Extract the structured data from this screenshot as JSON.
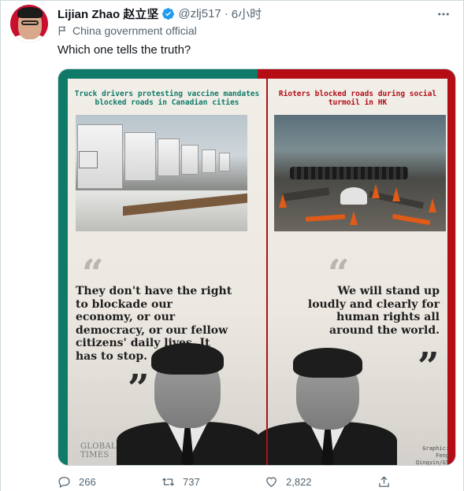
{
  "tweet": {
    "display_name": "Lijian Zhao 赵立坚",
    "handle": "@zlj517",
    "separator": "·",
    "time": "6小时",
    "affiliation": "China government official",
    "text": "Which one tells the truth?",
    "more_icon": "more-horizontal-icon",
    "verified_icon": "verified-badge-icon",
    "accent": "#1d9bf0"
  },
  "media": {
    "left_caption": "Truck drivers protesting vaccine mandates blocked roads in Canadian cities",
    "right_caption": "Rioters blocked roads during social turmoil in HK",
    "left_quote": "They don't have the right to blockade our economy, or our democracy, or our fellow citizens' daily lives. It has to stop.",
    "right_quote": "We will stand up loudly and clearly for human rights all around the world.",
    "open_quote": "“",
    "close_quote": "”",
    "logo_line1": "GLOBAL",
    "logo_line2": "TIMES",
    "credit_line1": "Graphic:",
    "credit_line2": "Feng Qingyin/GT",
    "left_color": "#0f7a67",
    "right_color": "#b40d16"
  },
  "actions": {
    "reply_count": "266",
    "retweet_count": "737",
    "like_count": "2,822",
    "reply_icon": "reply-icon",
    "retweet_icon": "retweet-icon",
    "like_icon": "heart-icon",
    "share_icon": "share-icon"
  }
}
